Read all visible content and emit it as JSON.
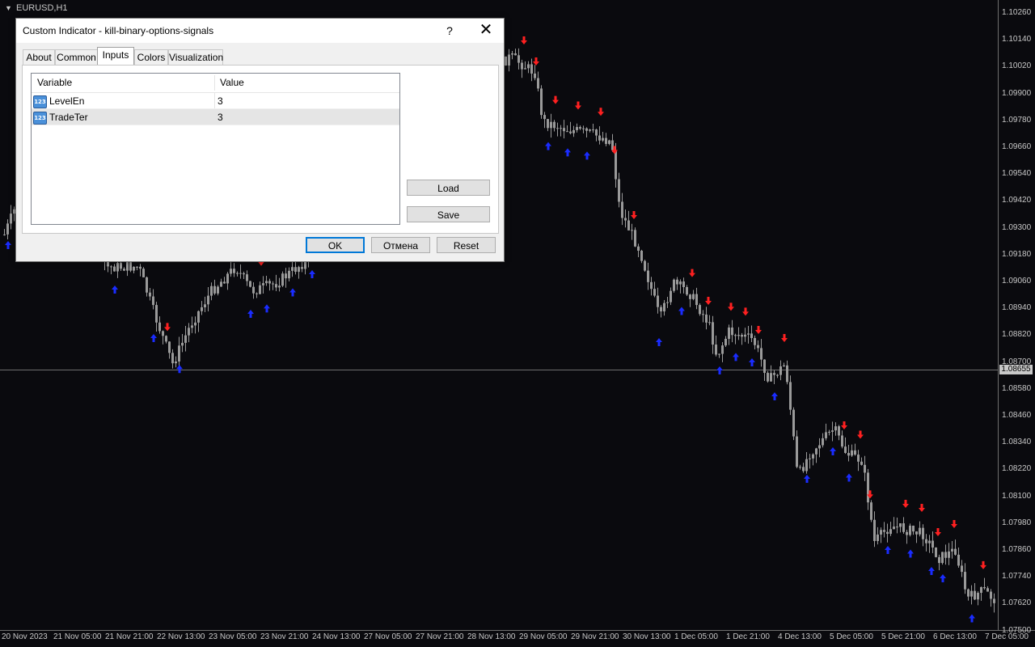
{
  "chart": {
    "symbol": "EURUSD,H1",
    "current_price": "1.08655",
    "price_axis": [
      "1.10260",
      "1.10140",
      "1.10020",
      "1.09900",
      "1.09780",
      "1.09660",
      "1.09540",
      "1.09420",
      "1.09300",
      "1.09180",
      "1.09060",
      "1.08940",
      "1.08820",
      "1.08700",
      "1.08580",
      "1.08460",
      "1.08340",
      "1.08220",
      "1.08100",
      "1.07980",
      "1.07860",
      "1.07740",
      "1.07620",
      "1.07500"
    ],
    "time_axis": [
      "20 Nov 2023",
      "21 Nov 05:00",
      "21 Nov 21:00",
      "22 Nov 13:00",
      "23 Nov 05:00",
      "23 Nov 21:00",
      "24 Nov 13:00",
      "27 Nov 05:00",
      "27 Nov 21:00",
      "28 Nov 13:00",
      "29 Nov 05:00",
      "29 Nov 21:00",
      "30 Nov 13:00",
      "1 Dec 05:00",
      "1 Dec 21:00",
      "4 Dec 13:00",
      "5 Dec 05:00",
      "5 Dec 21:00",
      "6 Dec 13:00",
      "7 Dec 05:00"
    ],
    "colors": {
      "background": "#0a0a0e",
      "candle": "#9a9a9a",
      "sell_arrow": "#ff2020",
      "buy_arrow": "#1a2cff",
      "price_line": "#6e6e6e"
    }
  },
  "dialog": {
    "title": "Custom Indicator - kill-binary-options-signals",
    "help_label": "?",
    "close_label": "✕",
    "tabs": [
      {
        "label": "About"
      },
      {
        "label": "Common"
      },
      {
        "label": "Inputs"
      },
      {
        "label": "Colors"
      },
      {
        "label": "Visualization"
      }
    ],
    "active_tab": "Inputs",
    "grid": {
      "columns": [
        "Variable",
        "Value"
      ],
      "rows": [
        {
          "icon": "numeric-123-icon",
          "icon_text": "123",
          "name": "LevelEn",
          "value": "3"
        },
        {
          "icon": "numeric-123-icon",
          "icon_text": "123",
          "name": "TradeTer",
          "value": "3"
        }
      ]
    },
    "load_label": "Load",
    "save_label": "Save",
    "ok_label": "OK",
    "cancel_label": "Отмена",
    "reset_label": "Reset"
  }
}
